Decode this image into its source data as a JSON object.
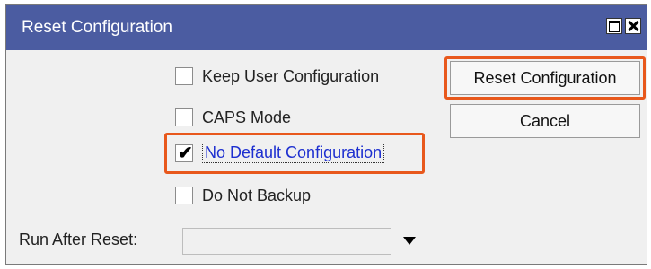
{
  "window": {
    "title": "Reset Configuration"
  },
  "options": [
    {
      "label": "Keep User Configuration",
      "checked": false
    },
    {
      "label": "CAPS Mode",
      "checked": false
    },
    {
      "label": "No Default Configuration",
      "checked": true
    },
    {
      "label": "Do Not Backup",
      "checked": false
    }
  ],
  "checkmark": "✔",
  "buttons": {
    "reset": "Reset Configuration",
    "cancel": "Cancel"
  },
  "run_after_reset": {
    "label": "Run After Reset:",
    "value": ""
  },
  "colors": {
    "titlebar": "#4b5ca1",
    "highlight": "#e8581c",
    "selected_text": "#1d2fd0"
  }
}
